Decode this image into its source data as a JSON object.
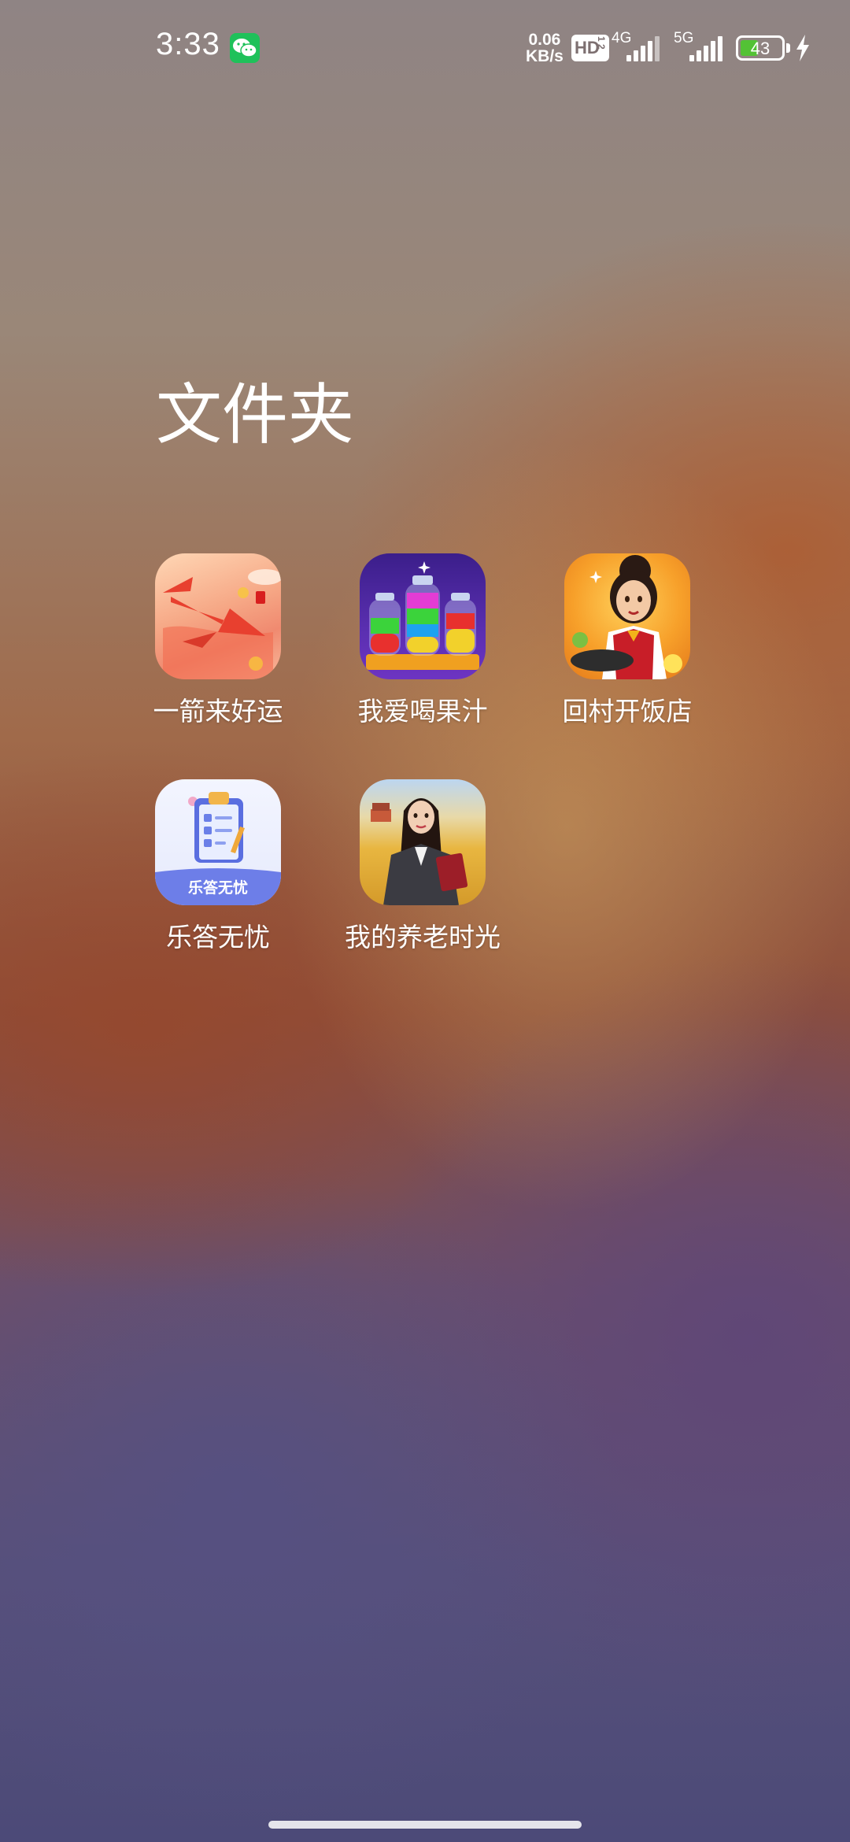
{
  "status_bar": {
    "time": "3:33",
    "net_speed_value": "0.06",
    "net_speed_unit": "KB/s",
    "hd_label": "HD",
    "hd_sub": "1 2",
    "signal1_label": "4G",
    "signal2_label": "5G",
    "battery_level": "43",
    "battery_fill_fraction": 0.43,
    "battery_color": "#53c235",
    "charging": true
  },
  "folder": {
    "title": "文件夹",
    "apps": [
      {
        "label": "一箭来好运",
        "icon": "arrow-luck-icon"
      },
      {
        "label": "我爱喝果汁",
        "icon": "juice-bottles-icon"
      },
      {
        "label": "回村开饭店",
        "icon": "chef-girl-icon"
      },
      {
        "label": "乐答无忧",
        "icon": "quiz-clipboard-icon",
        "icon_text": "乐答无忧"
      },
      {
        "label": "我的养老时光",
        "icon": "businesswoman-icon"
      }
    ]
  }
}
